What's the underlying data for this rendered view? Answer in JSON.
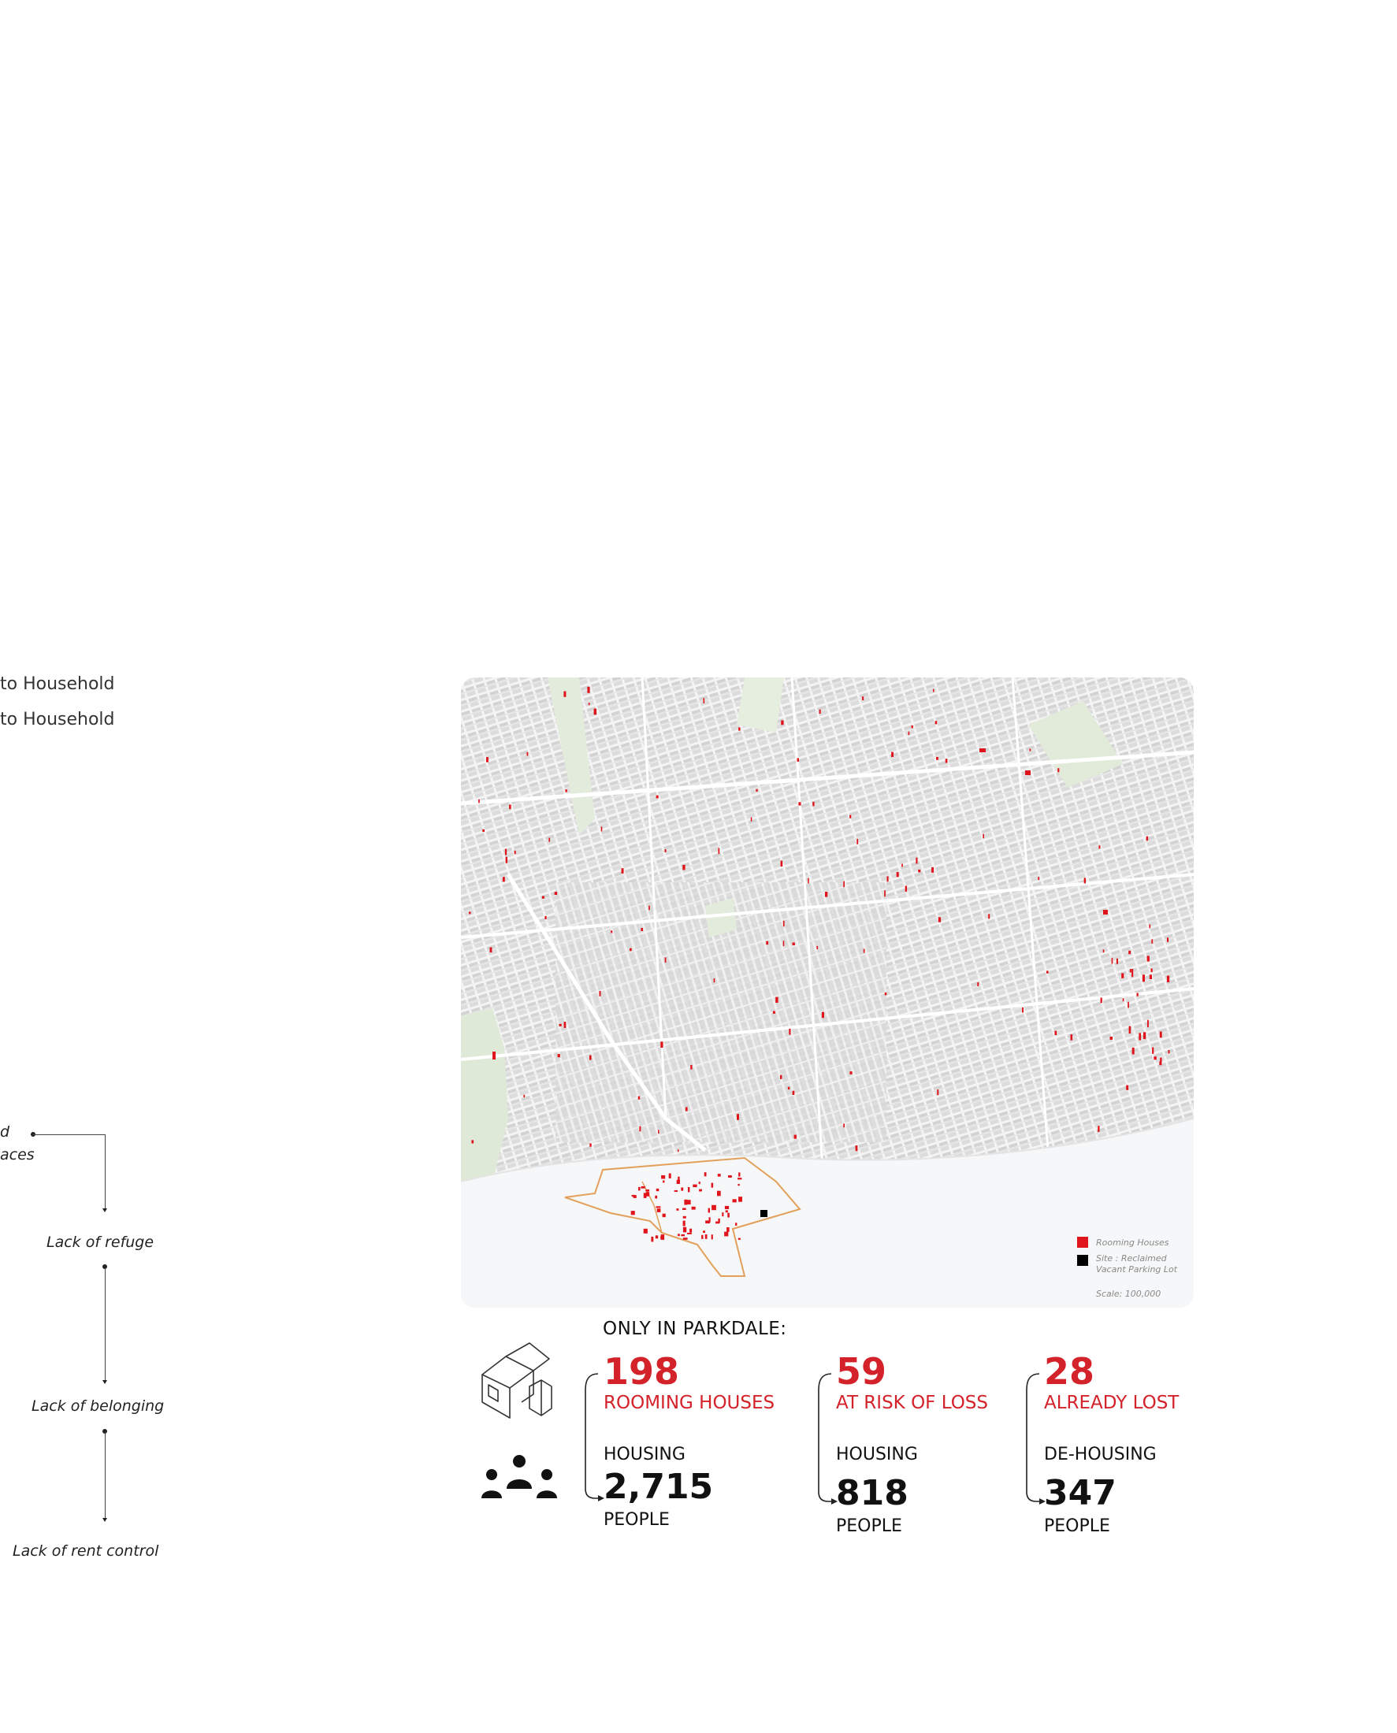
{
  "left_panel": {
    "household_line_1": "to Household",
    "household_line_2": "to Household",
    "fragment_1": "d",
    "fragment_2": "aces",
    "causes": [
      "Lack of refuge",
      "Lack of belonging",
      "Lack of rent control"
    ]
  },
  "map": {
    "legend": {
      "rooming_houses": "Rooming Houses",
      "site_line_1": "Site : Reclaimed",
      "site_line_2": "Vacant Parking Lot",
      "scale": "Scale: 100,000"
    },
    "colors": {
      "rooming_house": "#e0141b",
      "site": "#000000",
      "parkdale_boundary": "#e3a05b",
      "park": "#dfe9d7",
      "water": "#f6f7f8"
    }
  },
  "stats": {
    "heading": "ONLY IN PARKDALE:",
    "icons": [
      "house-icon",
      "people-icon"
    ],
    "columns": [
      {
        "number": "198",
        "label": "ROOMING HOUSES",
        "sub_label": "HOUSING",
        "people": "2,715",
        "people_label": "PEOPLE"
      },
      {
        "number": "59",
        "label": "AT RISK OF LOSS",
        "sub_label": "HOUSING",
        "people": "818",
        "people_label": "PEOPLE"
      },
      {
        "number": "28",
        "label": "ALREADY LOST",
        "sub_label": "DE-HOUSING",
        "people": "347",
        "people_label": "PEOPLE"
      }
    ]
  }
}
